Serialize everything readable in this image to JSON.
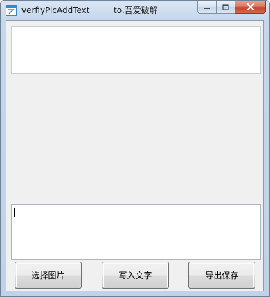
{
  "window": {
    "title": "verfiyPicAddText",
    "subtitle": "to.吾爱破解",
    "icon": "app-window-icon"
  },
  "caption_buttons": {
    "minimize_icon": "minimize-icon",
    "maximize_icon": "maximize-icon",
    "close_icon": "close-icon"
  },
  "top_textbox": {
    "value": ""
  },
  "bottom_textbox": {
    "value": ""
  },
  "buttons": {
    "select_image": "选择图片",
    "write_text": "写入文字",
    "export_save": "导出保存"
  },
  "colors": {
    "titlebar": "#c5d7ec",
    "client_bg": "#f0f0f0",
    "close_button": "#c7432a"
  }
}
